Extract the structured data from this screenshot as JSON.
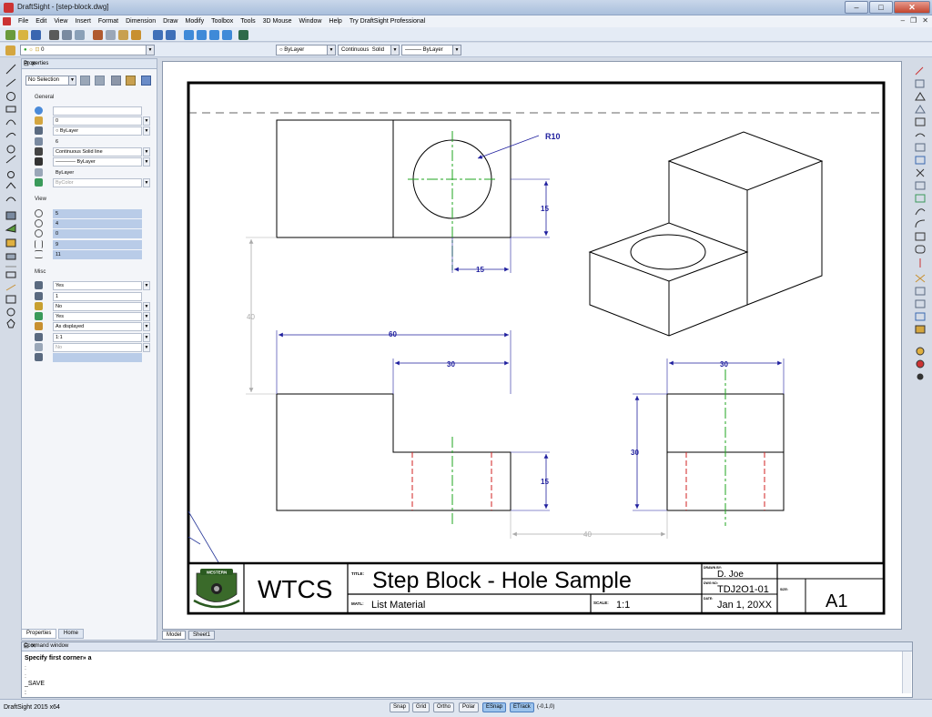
{
  "window": {
    "title": "DraftSight - [step-block.dwg]"
  },
  "menu": [
    "File",
    "Edit",
    "View",
    "Insert",
    "Format",
    "Dimension",
    "Draw",
    "Modify",
    "Toolbox",
    "Tools",
    "3D Mouse",
    "Window",
    "Help",
    "Try DraftSight Professional"
  ],
  "layer_bar": {
    "layer": "0",
    "color": "ByLayer",
    "linestyle": "Continuous",
    "linestyle_type": "Solid",
    "lineweight": "ByLayer"
  },
  "properties": {
    "title": "Properties",
    "selection": "No Selection",
    "general_label": "General",
    "general": [
      "",
      "0",
      "ByLayer",
      "6",
      "Continuous    Solid line",
      "———— ByLayer",
      "ByLayer",
      "ByColor"
    ],
    "view_label": "View",
    "view": [
      "5",
      "4",
      "0",
      "9",
      "11"
    ],
    "misc_label": "Misc",
    "misc": [
      "Yes",
      "1",
      "No",
      "Yes",
      "As displayed",
      "1:1",
      "No",
      ""
    ]
  },
  "panel_tabs": [
    "Properties",
    "Home"
  ],
  "sheet_tabs": [
    "Model",
    "Sheet1"
  ],
  "drawing": {
    "dims": {
      "r10": "R10",
      "d15_a": "15",
      "d15_b": "15",
      "d40_a": "40",
      "d60": "60",
      "d30_a": "30",
      "d15_c": "15",
      "d30_b": "30",
      "d30_c": "30",
      "d40_b": "40"
    },
    "title_block": {
      "school": "WTCS",
      "logo_text": "WESTERN",
      "title_label": "TITLE:",
      "title": "Step Block - Hole Sample",
      "matl_label": "MATL:",
      "material": "List Material",
      "scale_label": "SCALE:",
      "scale": "1:1",
      "drawn_label": "DRAWN BY:",
      "drawn_by": "D. Joe",
      "dwg_no_label": "DWG NO:",
      "dwg_no": "TDJ2O1-01",
      "date_label": "DATE:",
      "date": "Jan 1, 20XX",
      "size_label": "SIZE:",
      "size": "A1"
    }
  },
  "command": {
    "title": "Command window",
    "lines": [
      "Specify first corner» a",
      ":",
      ":",
      "_SAVE",
      ":"
    ]
  },
  "status": {
    "app": "DraftSight 2015 x64",
    "buttons": [
      "Snap",
      "Grid",
      "Ortho",
      "Polar",
      "ESnap",
      "ETrack"
    ],
    "active": [
      "ESnap",
      "ETrack"
    ],
    "coords": "(-0,1,0)"
  },
  "colors": {
    "dimension": "#1f1f9e",
    "centerline": "#1fa61f",
    "hidden": "#d22020",
    "accent": "#4a7cbf"
  }
}
